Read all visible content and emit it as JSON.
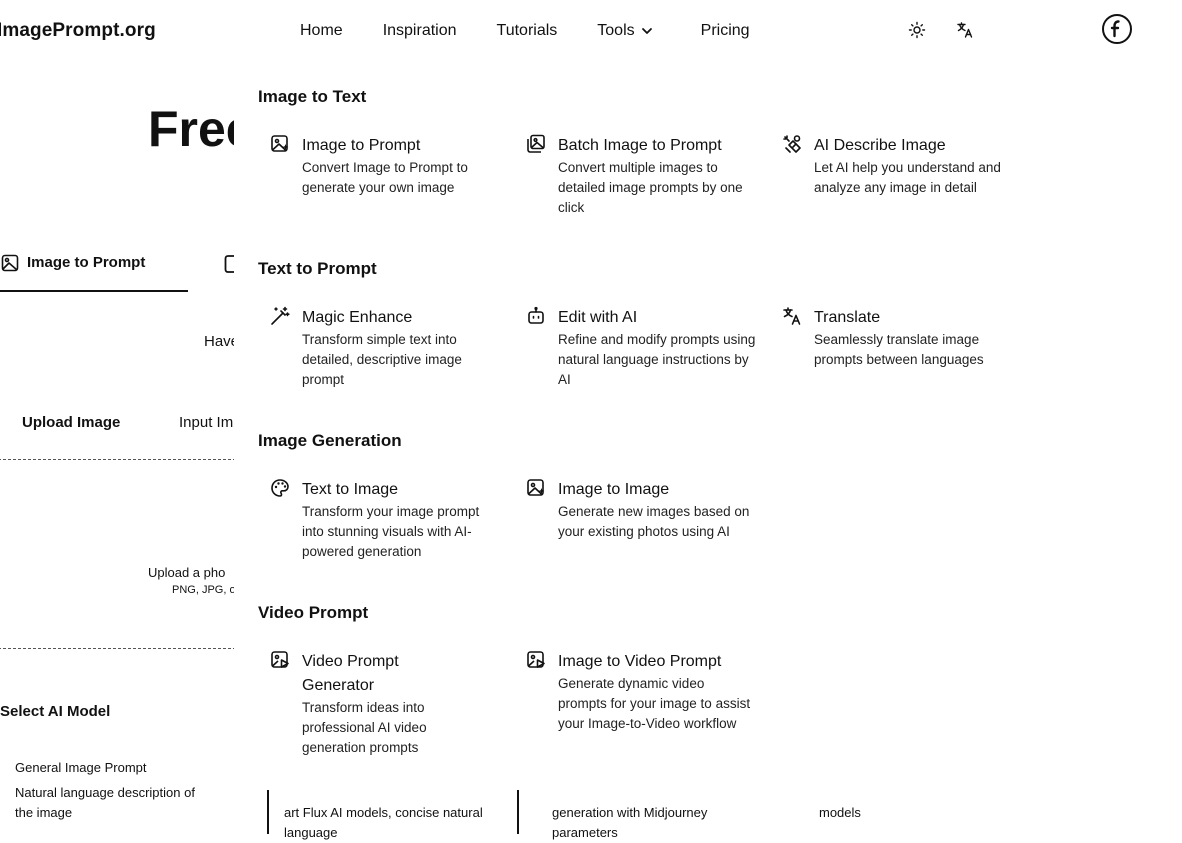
{
  "header": {
    "logo": "ImagePrompt.org",
    "nav": [
      {
        "label": "Home"
      },
      {
        "label": "Inspiration"
      },
      {
        "label": "Tutorials"
      },
      {
        "label": "Tools"
      },
      {
        "label": "Pricing"
      }
    ],
    "icons": [
      "sun-icon",
      "translate-icon",
      "avatar"
    ]
  },
  "page": {
    "title_partial": "Free",
    "tab_active": "Image to Prompt",
    "have_partial": "Have",
    "upload_tab": "Upload Image",
    "input_tab_partial": "Input Im",
    "upload_text_partial": "Upload a pho",
    "upload_formats_partial": "PNG, JPG, o",
    "select_model": "Select AI Model",
    "model_title": "General Image Prompt",
    "model_desc": "Natural language description of the image",
    "cards": [
      {
        "text": "art Flux AI models, concise natural language"
      },
      {
        "text": "generation with Midjourney parameters"
      },
      {
        "text": "models"
      }
    ]
  },
  "dropdown": {
    "sections": [
      {
        "title": "Image to Text",
        "items": [
          {
            "icon": "image-sparkle-icon",
            "title": "Image to Prompt",
            "desc": "Convert Image to Prompt to generate your own image"
          },
          {
            "icon": "images-stack-icon",
            "title": "Batch Image to Prompt",
            "desc": "Convert multiple images to detailed image prompts by one click"
          },
          {
            "icon": "ai-describe-icon",
            "title": "AI Describe Image",
            "desc": "Let AI help you understand and analyze any image in detail"
          }
        ]
      },
      {
        "title": "Text to Prompt",
        "items": [
          {
            "icon": "magic-wand-icon",
            "title": "Magic Enhance",
            "desc": "Transform simple text into detailed, descriptive image prompt"
          },
          {
            "icon": "bot-icon",
            "title": "Edit with AI",
            "desc": "Refine and modify prompts using natural language instructions by AI"
          },
          {
            "icon": "translate-icon",
            "title": "Translate",
            "desc": "Seamlessly translate image prompts between languages"
          }
        ]
      },
      {
        "title": "Image Generation",
        "items": [
          {
            "icon": "palette-icon",
            "title": "Text to Image",
            "desc": "Transform your image prompt into stunning visuals with AI-powered generation"
          },
          {
            "icon": "image-sparkle-icon",
            "title": "Image to Image",
            "desc": "Generate new images based on your existing photos using AI"
          }
        ]
      },
      {
        "title": "Video Prompt",
        "items": [
          {
            "icon": "video-image-icon",
            "title": "Video Prompt Generator",
            "desc": "Transform ideas into professional AI video generation prompts"
          },
          {
            "icon": "video-image-icon",
            "title": "Image to Video Prompt",
            "desc": "Generate dynamic video prompts for your image to assist your Image-to-Video workflow"
          }
        ]
      }
    ]
  }
}
